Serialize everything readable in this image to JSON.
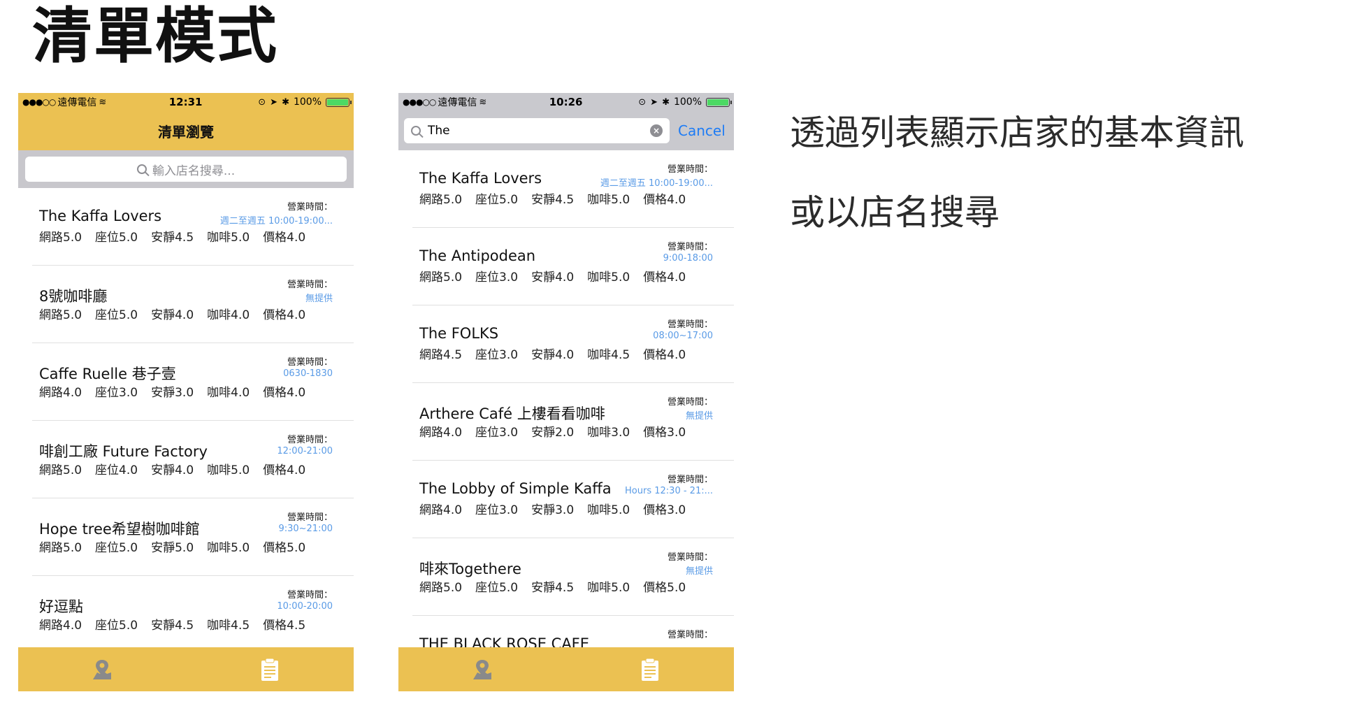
{
  "slide": {
    "title": "清單模式",
    "caption_line1": "透過列表顯示店家的基本資訊",
    "caption_line2": "或以店名搜尋"
  },
  "phone1": {
    "status": {
      "carrier": "遠傳電信",
      "time": "12:31",
      "battery": "100%"
    },
    "nav_title": "清單瀏覽",
    "search_placeholder": "輸入店名搜尋...",
    "items": [
      {
        "name": "The Kaffa Lovers",
        "hours_label": "營業時間：",
        "hours": "週二至週五 10:00-19:00...",
        "ratings": [
          "網路5.0",
          "座位5.0",
          "安靜4.5",
          "咖啡5.0",
          "價格4.0"
        ]
      },
      {
        "name": "8號咖啡廳",
        "hours_label": "營業時間：",
        "hours": "無提供",
        "ratings": [
          "網路5.0",
          "座位5.0",
          "安靜4.0",
          "咖啡4.0",
          "價格4.0"
        ]
      },
      {
        "name": "Caffe Ruelle 巷子壹",
        "hours_label": "營業時間：",
        "hours": "0630-1830",
        "ratings": [
          "網路4.0",
          "座位3.0",
          "安靜3.0",
          "咖啡4.0",
          "價格4.0"
        ]
      },
      {
        "name": "啡創工廠 Future Factory",
        "hours_label": "營業時間：",
        "hours": "12:00-21:00",
        "ratings": [
          "網路5.0",
          "座位4.0",
          "安靜4.0",
          "咖啡5.0",
          "價格4.0"
        ]
      },
      {
        "name": "Hope tree希望樹咖啡館",
        "hours_label": "營業時間：",
        "hours": "9:30~21:00",
        "ratings": [
          "網路5.0",
          "座位5.0",
          "安靜5.0",
          "咖啡5.0",
          "價格5.0"
        ]
      },
      {
        "name": "好逗點",
        "hours_label": "營業時間：",
        "hours": "10:00-20:00",
        "ratings": [
          "網路4.0",
          "座位5.0",
          "安靜4.5",
          "咖啡4.5",
          "價格4.5"
        ]
      }
    ]
  },
  "phone2": {
    "status": {
      "carrier": "遠傳電信",
      "time": "10:26",
      "battery": "100%"
    },
    "search_value": "The",
    "cancel_label": "Cancel",
    "items": [
      {
        "name": "The Kaffa Lovers",
        "hours_label": "營業時間：",
        "hours": "週二至週五 10:00-19:00...",
        "ratings": [
          "網路5.0",
          "座位5.0",
          "安靜4.5",
          "咖啡5.0",
          "價格4.0"
        ]
      },
      {
        "name": "The Antipodean",
        "hours_label": "營業時間：",
        "hours": "9:00-18:00",
        "ratings": [
          "網路5.0",
          "座位3.0",
          "安靜4.0",
          "咖啡5.0",
          "價格4.0"
        ]
      },
      {
        "name": "The FOLKS",
        "hours_label": "營業時間：",
        "hours": "08:00~17:00",
        "ratings": [
          "網路4.5",
          "座位3.0",
          "安靜4.0",
          "咖啡4.5",
          "價格4.0"
        ]
      },
      {
        "name": "Arthere Café 上樓看看咖啡",
        "hours_label": "營業時間：",
        "hours": "無提供",
        "ratings": [
          "網路4.0",
          "座位3.0",
          "安靜2.0",
          "咖啡3.0",
          "價格3.0"
        ]
      },
      {
        "name": "The Lobby of Simple Kaffa",
        "hours_label": "營業時間：",
        "hours": "Hours 12:30 - 21:...",
        "ratings": [
          "網路4.0",
          "座位3.0",
          "安靜3.0",
          "咖啡5.0",
          "價格3.0"
        ]
      },
      {
        "name": "啡來Togethere",
        "hours_label": "營業時間：",
        "hours": "無提供",
        "ratings": [
          "網路5.0",
          "座位5.0",
          "安靜4.5",
          "咖啡5.0",
          "價格5.0"
        ]
      },
      {
        "name": "THE BLACK ROSE CAFE",
        "hours_label": "營業時間：",
        "hours": "",
        "ratings": []
      }
    ]
  },
  "colors": {
    "accent": "#ebc152",
    "link": "#1e7cf5",
    "hours": "#5a9be6"
  },
  "icons": {
    "tab_map": "map-pin-icon",
    "tab_list": "clipboard-icon"
  }
}
